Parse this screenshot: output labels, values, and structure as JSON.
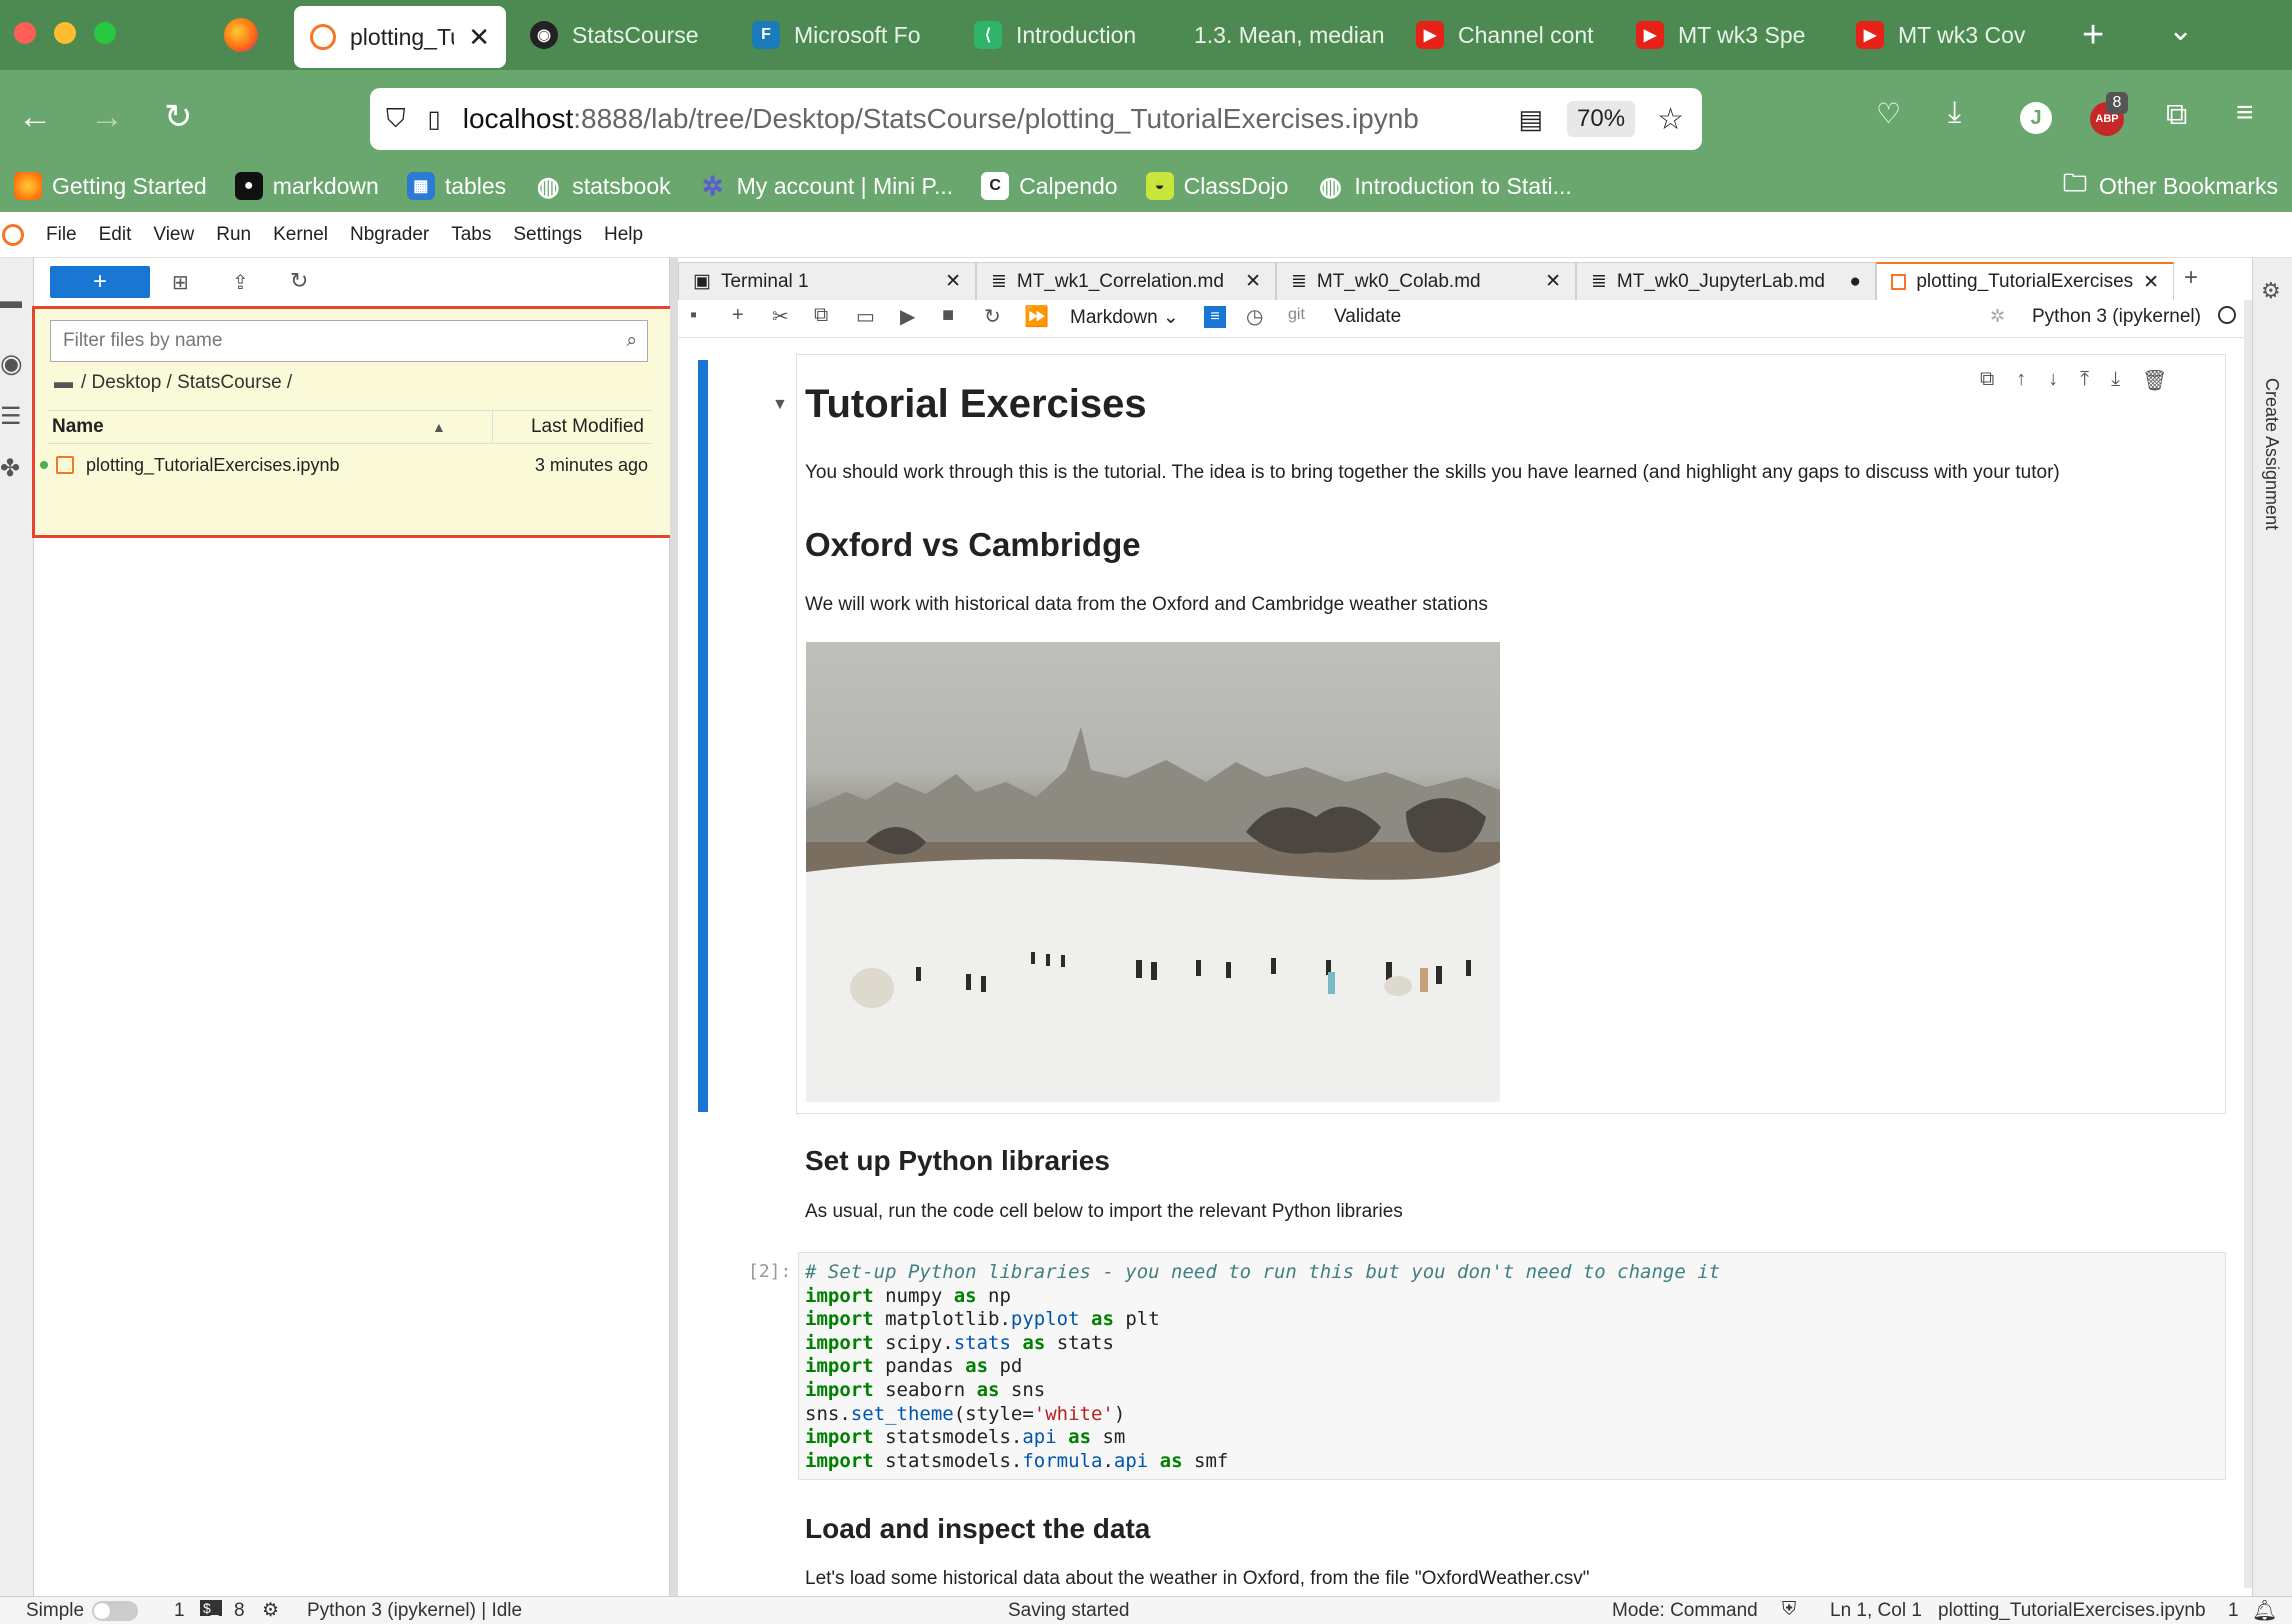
{
  "browser": {
    "tabs": [
      {
        "label": "plotting_Tu",
        "active": true
      },
      {
        "label": "StatsCourse"
      },
      {
        "label": "Microsoft Fo"
      },
      {
        "label": "Introduction"
      },
      {
        "label": "1.3. Mean, median"
      },
      {
        "label": "Channel cont"
      },
      {
        "label": "MT wk3 Spe"
      },
      {
        "label": "MT wk3 Cov"
      }
    ],
    "url_host": "localhost",
    "url_path": ":8888/lab/tree/Desktop/StatsCourse/plotting_TutorialExercises.ipynb",
    "zoom": "70%",
    "avatar_letter": "J",
    "badge_count": "8",
    "abp_label": "ABP",
    "bookmarks": [
      {
        "label": "Getting Started"
      },
      {
        "label": "markdown"
      },
      {
        "label": "tables"
      },
      {
        "label": "statsbook"
      },
      {
        "label": "My account | Mini P..."
      },
      {
        "label": "Calpendo"
      },
      {
        "label": "ClassDojo"
      },
      {
        "label": "Introduction to Stati..."
      }
    ],
    "other_bookmarks": "Other Bookmarks"
  },
  "menu": [
    "File",
    "Edit",
    "View",
    "Run",
    "Kernel",
    "Nbgrader",
    "Tabs",
    "Settings",
    "Help"
  ],
  "filebrowser": {
    "new_button": "+",
    "filter_placeholder": "Filter files by name",
    "breadcrumb": "/ Desktop / StatsCourse /",
    "col_name": "Name",
    "col_modified": "Last Modified",
    "files": [
      {
        "name": "plotting_TutorialExercises.ipynb",
        "modified": "3 minutes ago"
      }
    ]
  },
  "doctabs": [
    {
      "label": "Terminal 1"
    },
    {
      "label": "MT_wk1_Correlation.md"
    },
    {
      "label": "MT_wk0_Colab.md"
    },
    {
      "label": "MT_wk0_JupyterLab.md"
    },
    {
      "label": "plotting_TutorialExercises.ip"
    }
  ],
  "toolbar": {
    "cell_type": "Markdown",
    "git": "git",
    "validate": "Validate",
    "kernel": "Python 3 (ipykernel)"
  },
  "right_panel": {
    "label": "Create Assignment"
  },
  "notebook": {
    "title": "Tutorial Exercises",
    "intro": "You should work through this is the tutorial. The idea is to bring together the skills you have learned (and highlight any gaps to discuss with your tutor)",
    "h_oxford": "Oxford vs Cambridge",
    "p_oxford": "We will work with historical data from the Oxford and Cambridge weather stations",
    "h_setup": "Set up Python libraries",
    "p_setup": "As usual, run the code cell below to import the relevant Python libraries",
    "prompt": "[2]:",
    "code_comment": "# Set-up Python libraries - you need to run this but you don't need to change it",
    "h_load": "Load and inspect the data",
    "p_load": "Let's load some historical data about the weather in Oxford, from the file \"OxfordWeather.csv\""
  },
  "status": {
    "mode_label": "Simple",
    "count1": "1",
    "count2": "8",
    "kernel": "Python 3 (ipykernel) | Idle",
    "saving": "Saving started",
    "mode": "Mode: Command",
    "position": "Ln 1, Col 1",
    "filename": "plotting_TutorialExercises.ipynb",
    "notifications": "1"
  }
}
